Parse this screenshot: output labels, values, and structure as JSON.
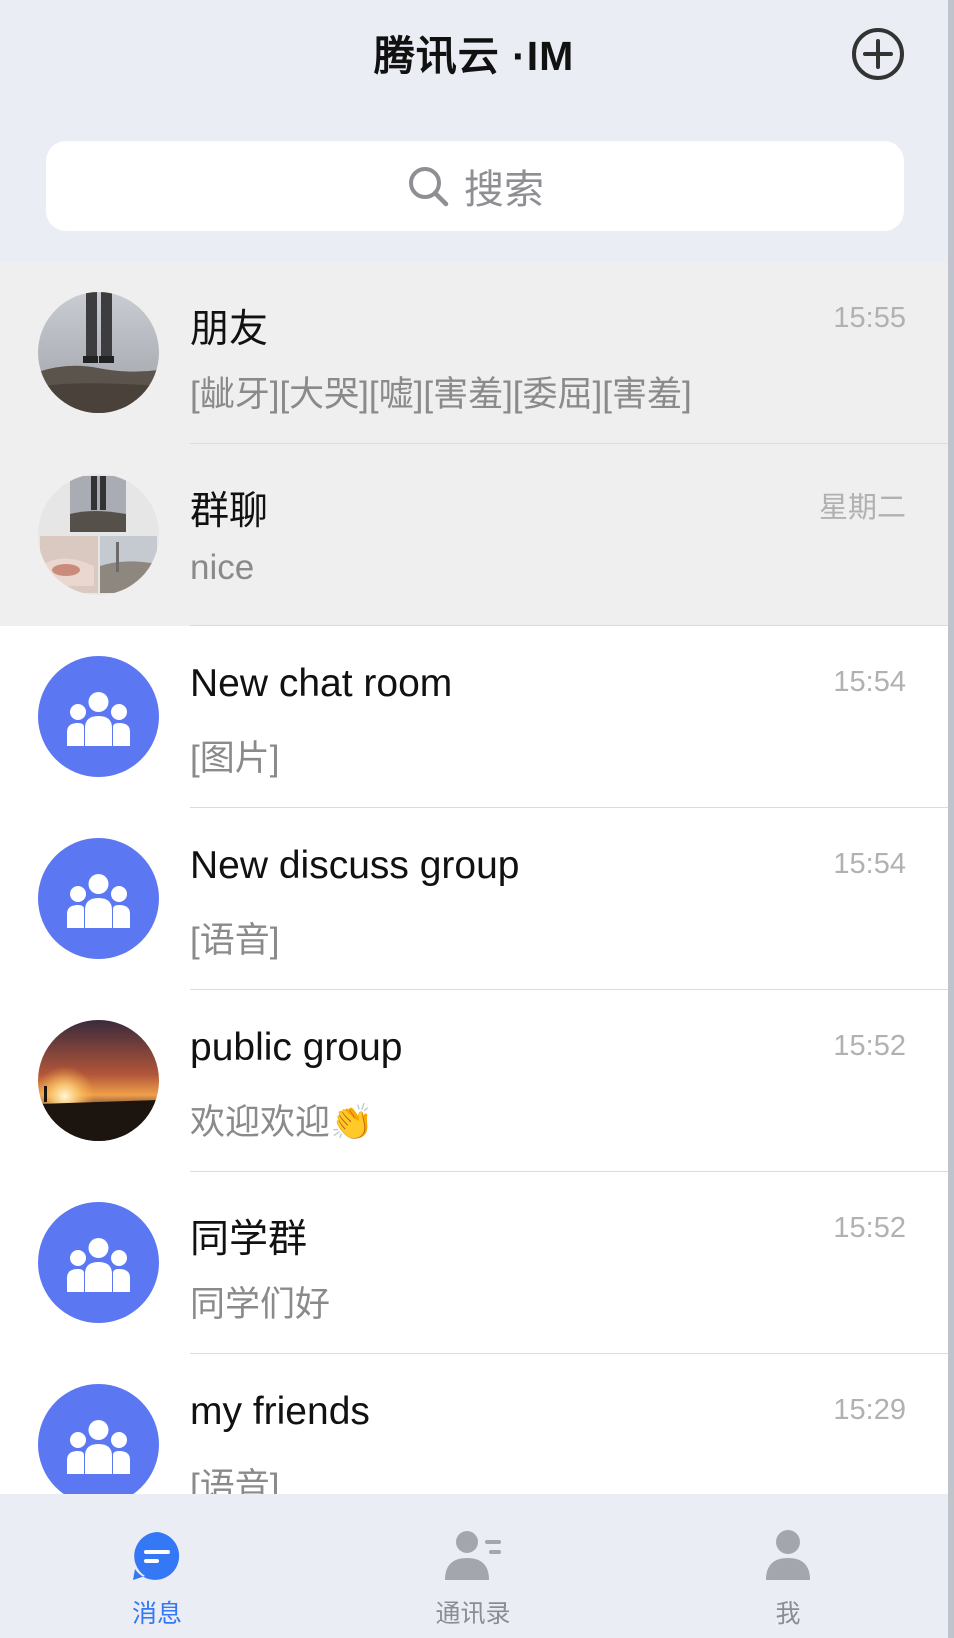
{
  "header": {
    "title": "腾讯云 ·IM",
    "add_icon": "plus-circle-icon"
  },
  "search": {
    "label": "搜索",
    "icon": "search-icon"
  },
  "conversations": [
    {
      "name": "朋友",
      "preview": "[龇牙][大哭][嘘][害羞][委屈][害羞]",
      "time": "15:55",
      "pinned": true,
      "avatar": "photo-legs"
    },
    {
      "name": "群聊",
      "preview": "nice",
      "time": "星期二",
      "pinned": true,
      "avatar": "photo-collage"
    },
    {
      "name": "New chat room",
      "preview": "[图片]",
      "time": "15:54",
      "pinned": false,
      "avatar": "group-icon"
    },
    {
      "name": "New discuss group",
      "preview": "[语音]",
      "time": "15:54",
      "pinned": false,
      "avatar": "group-icon"
    },
    {
      "name": "public group",
      "preview": "欢迎欢迎👏",
      "time": "15:52",
      "pinned": false,
      "avatar": "photo-sunset"
    },
    {
      "name": "同学群",
      "preview": "同学们好",
      "time": "15:52",
      "pinned": false,
      "avatar": "group-icon"
    },
    {
      "name": "my friends",
      "preview": "[语音]",
      "time": "15:29",
      "pinned": false,
      "avatar": "group-icon"
    }
  ],
  "tabbar": {
    "items": [
      {
        "label": "消息",
        "icon": "message-icon",
        "active": true
      },
      {
        "label": "通讯录",
        "icon": "contacts-icon",
        "active": false
      },
      {
        "label": "我",
        "icon": "profile-icon",
        "active": false
      }
    ]
  },
  "colors": {
    "accent": "#3478f6",
    "group_avatar": "#5b78f2",
    "inactive": "#a3a6ad",
    "header_bg": "#ebedf5"
  }
}
